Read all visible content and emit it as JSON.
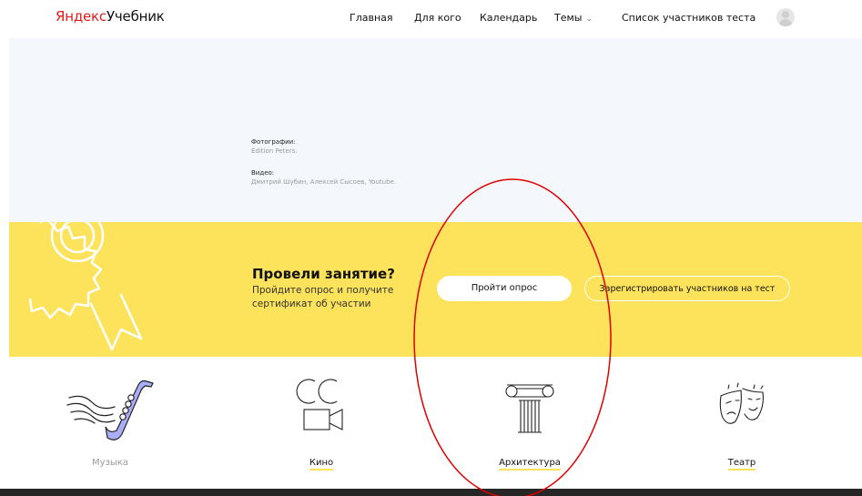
{
  "header": {
    "logo_ya": "Яндекс",
    "logo_tb": "Учебник",
    "nav": [
      "Главная",
      "Для кого",
      "Календарь",
      "Темы",
      "Список участников теста"
    ],
    "themes_chevron_icon": "chevron-down-icon",
    "avatar_icon": "user-avatar-icon"
  },
  "credits": {
    "photos_title": "Фотографии:",
    "photos_value": "Edition Peters.",
    "video_title": "Видео:",
    "video_value": "Дмитрий Шубин, Алексей Сысоев, Youtube."
  },
  "promo": {
    "title": "Провели занятие?",
    "subtitle": "Пройдите опрос и получите сертификат об участии",
    "survey_button": "Пройти опрос",
    "register_button": "Зарегистрировать участников на тест",
    "medal_icon": "medal-icon"
  },
  "topics": [
    {
      "label": "Музыка",
      "icon": "saxophone-icon"
    },
    {
      "label": "Кино",
      "icon": "cinema-icon"
    },
    {
      "label": "Архитектура",
      "icon": "column-icon"
    },
    {
      "label": "Театр",
      "icon": "theatre-masks-icon"
    }
  ],
  "colors": {
    "brand_red": "#e31b1b",
    "yellow": "#fce35b",
    "light_band": "#f4f7fb",
    "annotation": "#e00000"
  }
}
